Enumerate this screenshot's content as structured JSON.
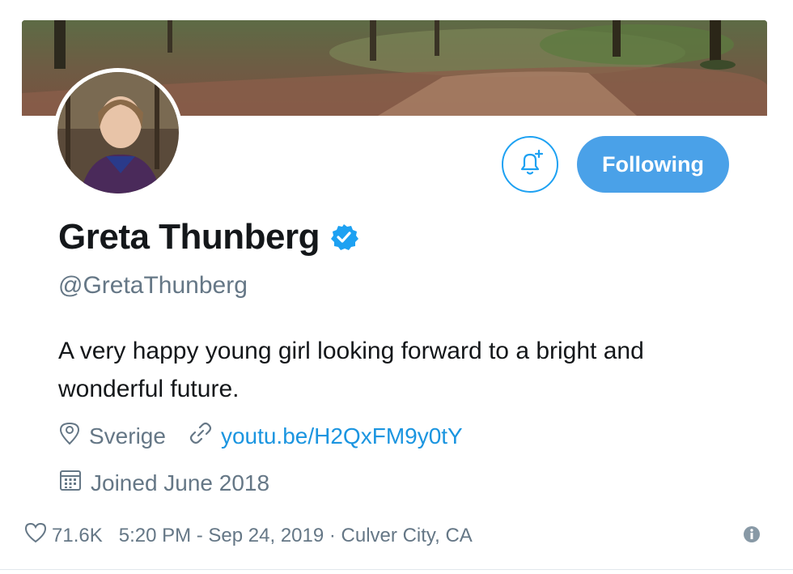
{
  "profile": {
    "name": "Greta Thunberg",
    "handle": "@GretaThunberg",
    "bio": "A very happy young girl looking forward to a bright and wonderful future.",
    "location": "Sverige",
    "website": "youtu.be/H2QxFM9y0tY",
    "joined": "Joined June 2018",
    "verified": true
  },
  "actions": {
    "follow_label": "Following",
    "notify_icon": "bell-plus-icon"
  },
  "footer": {
    "likes": "71.6K",
    "timestamp": "5:20 PM - Sep 24, 2019 · Culver City, CA",
    "info_icon": "info-icon"
  },
  "colors": {
    "accent": "#1da1f2",
    "button_fill": "#4aa1e8",
    "link": "#1b95e0",
    "secondary_text": "#657786"
  }
}
